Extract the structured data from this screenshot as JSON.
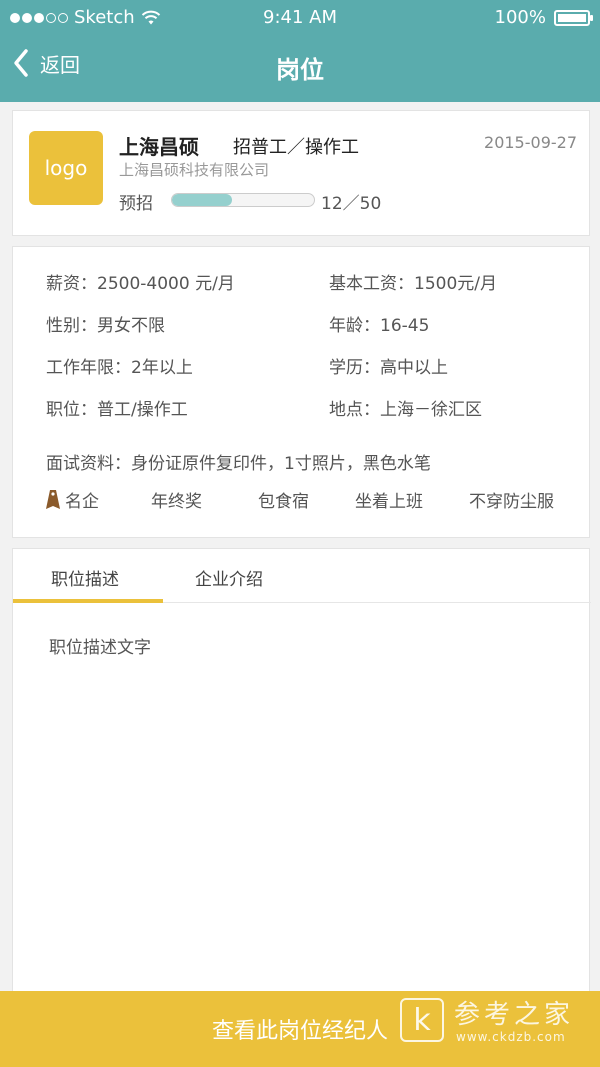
{
  "status_bar": {
    "carrier": "Sketch",
    "time": "9:41 AM",
    "battery": "100%",
    "signal_bars_filled": 3,
    "signal_bars_total": 5
  },
  "nav": {
    "back_label": "返回",
    "title": "岗位"
  },
  "job_card": {
    "logo_text": "logo",
    "company_short": "上海昌硕",
    "position": "招普工／操作工",
    "date": "2015-09-27",
    "company_full": "上海昌硕科技有限公司",
    "plan_label": "预招",
    "progress_text": "12／50",
    "hired": 12,
    "total": 50
  },
  "details": {
    "salary": "薪资：2500-4000 元/月",
    "base_salary": "基本工资：1500元/月",
    "gender": "性别：男女不限",
    "age": "年龄：16-45",
    "experience": "工作年限：2年以上",
    "education": "学历：高中以上",
    "job_position": "职位：普工/操作工",
    "location": "地点：上海－徐汇区",
    "interview_materials": "面试资料：身份证原件复印件，1寸照片，黑色水笔",
    "tags": [
      "名企",
      "年终奖",
      "包食宿",
      "坐着上班",
      "不穿防尘服"
    ]
  },
  "tabs": {
    "items": [
      "职位描述",
      "企业介绍"
    ],
    "active_index": 0
  },
  "description": "职位描述文字",
  "bottom_button": "查看此岗位经纪人",
  "watermark": {
    "letter": "k",
    "title": "参考之家",
    "url": "www.ckdzb.com"
  },
  "colors": {
    "header": "#5aacad",
    "accent": "#ebc13b",
    "progress": "#95d0ce",
    "tag_icon": "#8a5a2b"
  }
}
